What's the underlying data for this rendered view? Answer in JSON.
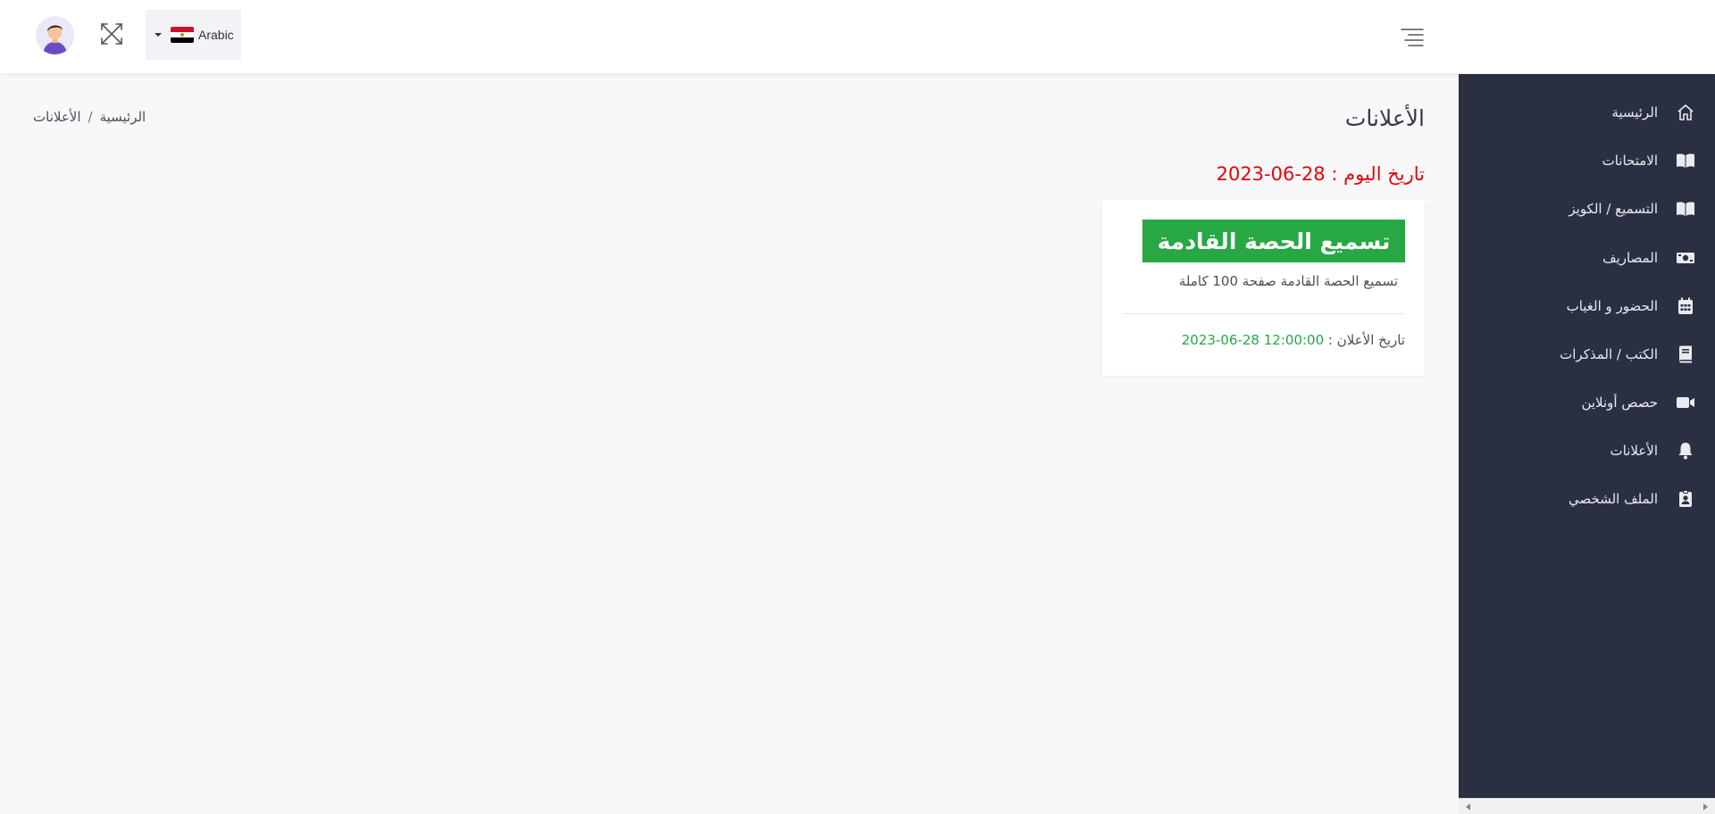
{
  "header": {
    "language": {
      "label": "Arabic",
      "flag": "egypt-flag-icon"
    },
    "icons": {
      "fullscreen": "fullscreen-icon",
      "menu": "menu-toggle-icon",
      "avatar": "user-avatar"
    }
  },
  "sidebar": {
    "items": [
      {
        "label": "الرئيسية",
        "icon": "home-icon"
      },
      {
        "label": "الامتحانات",
        "icon": "book-open-icon"
      },
      {
        "label": "التسميع / الكويز",
        "icon": "book-open-icon"
      },
      {
        "label": "المصاريف",
        "icon": "money-icon"
      },
      {
        "label": "الحضور و الغياب",
        "icon": "calendar-icon"
      },
      {
        "label": "الكتب / المذكرات",
        "icon": "book-icon"
      },
      {
        "label": "حصص أونلاين",
        "icon": "video-icon"
      },
      {
        "label": "الأعلانات",
        "icon": "bell-icon"
      },
      {
        "label": "الملف الشخصي",
        "icon": "id-badge-icon"
      }
    ]
  },
  "main": {
    "title": "الأعلانات",
    "breadcrumb": {
      "home": "الرئيسية",
      "separator": "/",
      "current": "الأعلانات"
    },
    "today": {
      "label": "تاريخ اليوم :",
      "value": "28-06-2023"
    },
    "announcement": {
      "title": "تسميع الحصة القادمة",
      "description": "تسميع الحصة القادمة صفحة 100 كاملة",
      "date_label": "تاريخ الأعلان :",
      "date_value": "12:00:00 28-06-2023"
    }
  },
  "colors": {
    "sidebar_bg": "#2a3042",
    "accent_green": "#28a745",
    "date_red": "#e3050a"
  }
}
